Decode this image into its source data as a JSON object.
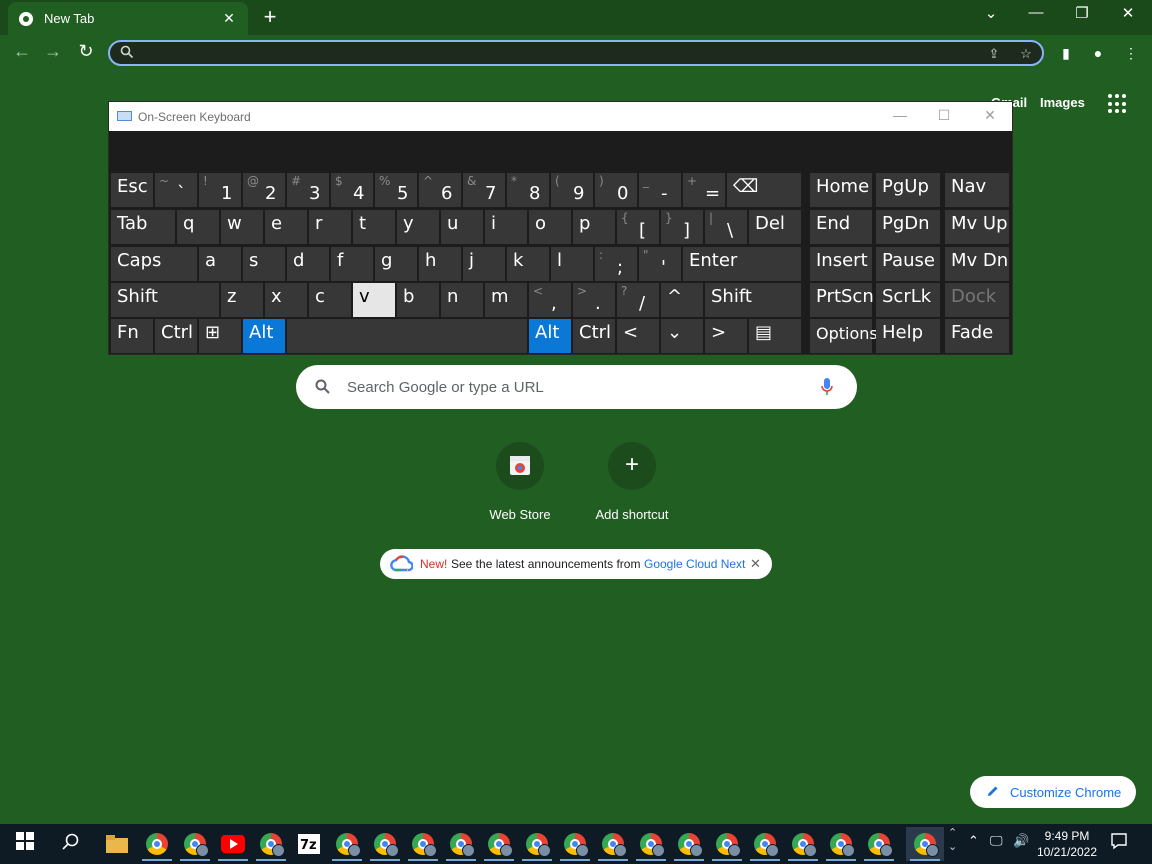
{
  "browser": {
    "tab_title": "New Tab",
    "tab_close": "✕",
    "new_tab": "+",
    "window_controls": [
      "⌄",
      "—",
      "❐",
      "✕"
    ],
    "omnibox_value": ""
  },
  "ntp": {
    "gmail": "Gmail",
    "images": "Images",
    "search_placeholder": "Search Google or type a URL",
    "shortcuts": [
      {
        "label": "Web Store"
      },
      {
        "label": "Add shortcut",
        "icon": "+"
      }
    ],
    "promo": {
      "new": "New!",
      "text": "See the latest announcements from",
      "link": "Google Cloud Next"
    },
    "customize": "Customize Chrome"
  },
  "osk": {
    "title": "On-Screen Keyboard",
    "row1": [
      {
        "l": "Esc"
      },
      {
        "s": "~",
        "m": "`"
      },
      {
        "s": "!",
        "m": "1"
      },
      {
        "s": "@",
        "m": "2"
      },
      {
        "s": "#",
        "m": "3"
      },
      {
        "s": "$",
        "m": "4"
      },
      {
        "s": "%",
        "m": "5"
      },
      {
        "s": "^",
        "m": "6"
      },
      {
        "s": "&",
        "m": "7"
      },
      {
        "s": "*",
        "m": "8"
      },
      {
        "s": "(",
        "m": "9"
      },
      {
        "s": ")",
        "m": "0"
      },
      {
        "s": "_",
        "m": "-"
      },
      {
        "s": "+",
        "m": "="
      },
      {
        "l": "⌫"
      },
      {
        "l": "Home"
      },
      {
        "l": "PgUp"
      },
      {
        "l": "Nav"
      }
    ],
    "row2": [
      {
        "l": "Tab"
      },
      {
        "l": "q"
      },
      {
        "l": "w"
      },
      {
        "l": "e"
      },
      {
        "l": "r"
      },
      {
        "l": "t"
      },
      {
        "l": "y"
      },
      {
        "l": "u"
      },
      {
        "l": "i"
      },
      {
        "l": "o"
      },
      {
        "l": "p"
      },
      {
        "s": "{",
        "m": "["
      },
      {
        "s": "}",
        "m": "]"
      },
      {
        "s": "|",
        "m": "\\"
      },
      {
        "l": "Del"
      },
      {
        "l": "End"
      },
      {
        "l": "PgDn"
      },
      {
        "l": "Mv Up"
      }
    ],
    "row3": [
      {
        "l": "Caps"
      },
      {
        "l": "a"
      },
      {
        "l": "s"
      },
      {
        "l": "d"
      },
      {
        "l": "f"
      },
      {
        "l": "g"
      },
      {
        "l": "h"
      },
      {
        "l": "j"
      },
      {
        "l": "k"
      },
      {
        "l": "l"
      },
      {
        "s": ":",
        "m": ";"
      },
      {
        "s": "\"",
        "m": "'"
      },
      {
        "l": "Enter"
      },
      {
        "l": "Insert"
      },
      {
        "l": "Pause"
      },
      {
        "l": "Mv Dn"
      }
    ],
    "row4": [
      {
        "l": "Shift"
      },
      {
        "l": "z"
      },
      {
        "l": "x"
      },
      {
        "l": "c"
      },
      {
        "l": "v"
      },
      {
        "l": "b"
      },
      {
        "l": "n"
      },
      {
        "l": "m"
      },
      {
        "s": "<",
        "m": ","
      },
      {
        "s": ">",
        "m": "."
      },
      {
        "s": "?",
        "m": "/"
      },
      {
        "l": "^"
      },
      {
        "l": "Shift"
      },
      {
        "l": "PrtScn"
      },
      {
        "l": "ScrLk"
      },
      {
        "l": "Dock"
      }
    ],
    "row5": [
      {
        "l": "Fn"
      },
      {
        "l": "Ctrl"
      },
      {
        "l": "⊞"
      },
      {
        "l": "Alt"
      },
      {
        "l": ""
      },
      {
        "l": "Alt"
      },
      {
        "l": "Ctrl"
      },
      {
        "l": "<"
      },
      {
        "l": "⌄"
      },
      {
        "l": ">"
      },
      {
        "l": "▤"
      },
      {
        "l": "Options"
      },
      {
        "l": "Help"
      },
      {
        "l": "Fade"
      }
    ]
  },
  "taskbar": {
    "time": "9:49 PM",
    "date": "10/21/2022"
  },
  "colors": {
    "background": "#215e21",
    "accent": "#0a78d7",
    "link": "#1a73e8"
  }
}
